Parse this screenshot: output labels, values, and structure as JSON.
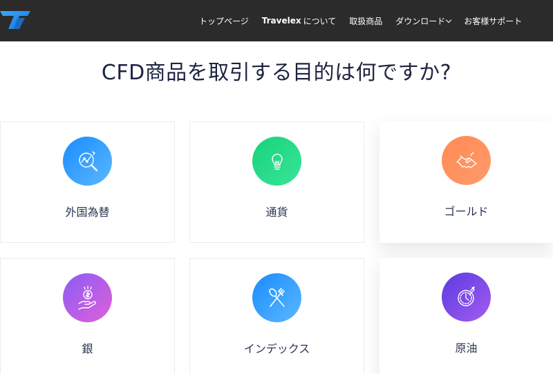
{
  "nav": {
    "items": [
      {
        "label": "トップページ"
      },
      {
        "label_bold": "Travelex",
        "label": "について"
      },
      {
        "label": "取扱商品"
      },
      {
        "label": "ダウンロード"
      },
      {
        "label": "お客様サポート"
      }
    ]
  },
  "page": {
    "title": "CFD商品を取引する目的は何ですか?"
  },
  "cards": [
    {
      "label": "外国為替",
      "icon": "magnifier-chart-icon",
      "color_from": "#1a8cff",
      "color_to": "#5ab8ff"
    },
    {
      "label": "通貨",
      "icon": "lightbulb-icon",
      "color_from": "#19d27a",
      "color_to": "#38e59a"
    },
    {
      "label": "ゴールド",
      "icon": "handshake-icon",
      "color_from": "#ff8a55",
      "color_to": "#ff9b6a"
    },
    {
      "label": "銀",
      "icon": "hand-coin-icon",
      "color_from": "#8b5cf6",
      "color_to": "#e060d8"
    },
    {
      "label": "インデックス",
      "icon": "fork-spoon-icon",
      "color_from": "#1a8cff",
      "color_to": "#5ab8ff"
    },
    {
      "label": "原油",
      "icon": "clock-target-icon",
      "color_from": "#5b3be0",
      "color_to": "#a45cf0"
    }
  ]
}
